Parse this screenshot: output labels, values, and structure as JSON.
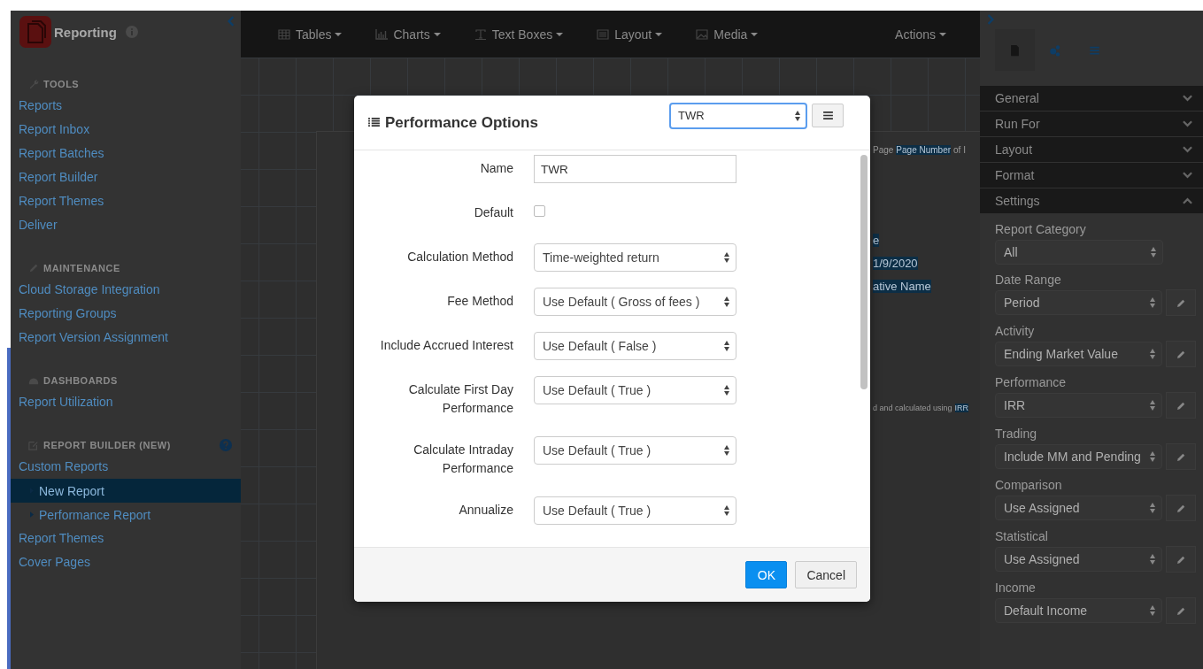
{
  "app": {
    "title": "Reporting"
  },
  "sidebar": {
    "sections": [
      {
        "kind": "tools",
        "heading": "TOOLS",
        "help": false,
        "items": [
          {
            "label": "Reports",
            "selected": false
          },
          {
            "label": "Report Inbox",
            "selected": false
          },
          {
            "label": "Report Batches",
            "selected": false
          },
          {
            "label": "Report Builder",
            "selected": false
          },
          {
            "label": "Report Themes",
            "selected": false
          },
          {
            "label": "Deliver",
            "selected": false
          }
        ]
      },
      {
        "kind": "maintenance",
        "heading": "MAINTENANCE",
        "help": false,
        "items": [
          {
            "label": "Cloud Storage Integration",
            "selected": false
          },
          {
            "label": "Reporting Groups",
            "selected": false
          },
          {
            "label": "Report Version Assignment",
            "selected": false
          }
        ]
      },
      {
        "kind": "dashboards",
        "heading": "DASHBOARDS",
        "help": false,
        "items": [
          {
            "label": "Report Utilization",
            "selected": false
          }
        ]
      },
      {
        "kind": "builder",
        "heading": "REPORT BUILDER (NEW)",
        "help": true,
        "items": [
          {
            "label": "Custom Reports",
            "selected": false,
            "children": [
              {
                "label": "New Report",
                "selected": true
              },
              {
                "label": "Performance Report",
                "selected": false
              }
            ]
          },
          {
            "label": "Report Themes",
            "selected": false
          },
          {
            "label": "Cover Pages",
            "selected": false
          }
        ]
      }
    ]
  },
  "toolbar": {
    "menus": [
      {
        "kind": "tables",
        "label": "Tables"
      },
      {
        "kind": "charts",
        "label": "Charts"
      },
      {
        "kind": "text",
        "label": "Text Boxes"
      },
      {
        "kind": "layout",
        "label": "Layout"
      },
      {
        "kind": "media",
        "label": "Media"
      }
    ],
    "actions": "Actions"
  },
  "page": {
    "lines": [
      {
        "parts": [
          {
            "text": "Page",
            "highlight": false
          },
          {
            "text": "Page Number",
            "highlight": true
          },
          {
            "text": "of I",
            "highlight": false
          }
        ],
        "kind": "header"
      },
      {
        "parts": [
          {
            "text": "e",
            "highlight": true
          }
        ],
        "kind": "body"
      },
      {
        "parts": [
          {
            "text": "1/9/2020",
            "highlight": true
          }
        ],
        "kind": "body"
      },
      {
        "parts": [
          {
            "text": "ative Name",
            "highlight": true
          }
        ],
        "kind": "body"
      },
      {
        "parts": [
          {
            "text": "d and calculated using",
            "highlight": false
          },
          {
            "text": "IRR",
            "highlight": true
          }
        ],
        "kind": "footnote"
      }
    ]
  },
  "right_panel": {
    "tabs": [
      {
        "kind": "document",
        "selected": true
      },
      {
        "kind": "gears",
        "selected": false
      },
      {
        "kind": "list",
        "selected": false
      }
    ],
    "sections": [
      {
        "title": "General",
        "expanded": false
      },
      {
        "title": "Run For",
        "expanded": false
      },
      {
        "title": "Layout",
        "expanded": false
      },
      {
        "title": "Format",
        "expanded": false
      },
      {
        "title": "Settings",
        "expanded": true
      }
    ],
    "fields": [
      {
        "label": "Report Category",
        "value": "All",
        "editable": false
      },
      {
        "label": "Date Range",
        "value": "Period",
        "editable": true
      },
      {
        "label": "Activity",
        "value": "Ending Market Value",
        "editable": true
      },
      {
        "label": "Performance",
        "value": "IRR",
        "editable": true
      },
      {
        "label": "Trading",
        "value": "Include MM and Pending",
        "editable": true
      },
      {
        "label": "Comparison",
        "value": "Use Assigned",
        "editable": true
      },
      {
        "label": "Statistical",
        "value": "Use Assigned",
        "editable": true
      },
      {
        "label": "Income",
        "value": "Default Income",
        "editable": true
      }
    ]
  },
  "modal": {
    "title": "Performance Options",
    "preset": "TWR",
    "fields": [
      {
        "kind": "text",
        "label": "Name",
        "value": "TWR"
      },
      {
        "kind": "checkbox",
        "label": "Default",
        "checked": false
      },
      {
        "kind": "select",
        "label": "Calculation Method",
        "value": "Time-weighted return"
      },
      {
        "kind": "select",
        "label": "Fee Method",
        "value": "Use Default ( Gross of fees )"
      },
      {
        "kind": "select",
        "label": "Include Accrued Interest",
        "value": "Use Default ( False )"
      },
      {
        "kind": "select",
        "label": "Calculate First Day Performance",
        "value": "Use Default ( True )"
      },
      {
        "kind": "select",
        "label": "Calculate Intraday Performance",
        "value": "Use Default ( True )"
      },
      {
        "kind": "select",
        "label": "Annualize",
        "value": "Use Default ( True )"
      }
    ],
    "buttons": [
      {
        "kind": "primary",
        "label": "OK"
      },
      {
        "kind": "default",
        "label": "Cancel"
      }
    ]
  }
}
